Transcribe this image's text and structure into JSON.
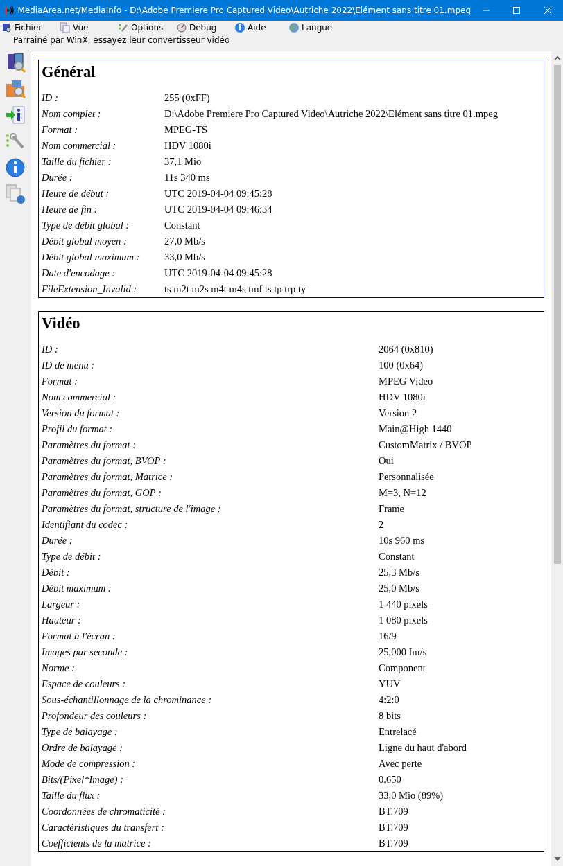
{
  "window": {
    "title": "MediaArea.net/MediaInfo - D:\\Adobe Premiere Pro Captured Video\\Autriche 2022\\Elément sans titre 01.mpeg"
  },
  "menu": [
    {
      "label": "Fichier",
      "kind": "file"
    },
    {
      "label": "Vue",
      "kind": "view"
    },
    {
      "label": "Options",
      "kind": "options"
    },
    {
      "label": "Debug",
      "kind": "debug"
    },
    {
      "label": "Aide",
      "kind": "help"
    },
    {
      "label": "Langue",
      "kind": "language"
    }
  ],
  "sponsor": "Parrainé par WinX, essayez leur convertisseur vidéo",
  "toolbar": [
    {
      "kind": "open-file"
    },
    {
      "kind": "open-folder"
    },
    {
      "kind": "export"
    },
    {
      "kind": "preferences"
    },
    {
      "kind": "about"
    },
    {
      "kind": "sheet"
    }
  ],
  "sections": [
    {
      "title": "Général",
      "kind": "general",
      "rows": [
        {
          "key": "ID :",
          "value": "255 (0xFF)"
        },
        {
          "key": "Nom complet :",
          "value": "D:\\Adobe Premiere Pro Captured Video\\Autriche 2022\\Elément sans titre 01.mpeg"
        },
        {
          "key": "Format :",
          "value": "MPEG-TS"
        },
        {
          "key": "Nom commercial :",
          "value": "HDV 1080i"
        },
        {
          "key": "Taille du fichier :",
          "value": "37,1 Mio"
        },
        {
          "key": "Durée :",
          "value": "11s 340 ms"
        },
        {
          "key": "Heure de début :",
          "value": "UTC 2019-04-04 09:45:28"
        },
        {
          "key": "Heure de fin :",
          "value": "UTC 2019-04-04 09:46:34"
        },
        {
          "key": "Type de débit global :",
          "value": "Constant"
        },
        {
          "key": "Débit global moyen :",
          "value": "27,0 Mb/s"
        },
        {
          "key": "Débit global maximum :",
          "value": "33,0 Mb/s"
        },
        {
          "key": "Date d'encodage :",
          "value": "UTC 2019-04-04 09:45:28"
        },
        {
          "key": "FileExtension_Invalid :",
          "value": "ts m2t m2s m4t m4s tmf ts tp trp ty"
        }
      ]
    },
    {
      "title": "Vidéo",
      "kind": "video",
      "rows": [
        {
          "key": "ID :",
          "value": "2064 (0x810)"
        },
        {
          "key": "ID de menu :",
          "value": "100 (0x64)"
        },
        {
          "key": "Format :",
          "value": "MPEG Video"
        },
        {
          "key": "Nom commercial :",
          "value": "HDV 1080i"
        },
        {
          "key": "Version du format :",
          "value": "Version 2"
        },
        {
          "key": "Profil du format :",
          "value": "Main@High 1440"
        },
        {
          "key": "Paramètres du format :",
          "value": "CustomMatrix / BVOP"
        },
        {
          "key": "Paramètres du format, BVOP :",
          "value": "Oui"
        },
        {
          "key": "Paramètres du format, Matrice :",
          "value": "Personnalisée"
        },
        {
          "key": "Paramètres du format, GOP :",
          "value": "M=3, N=12"
        },
        {
          "key": "Paramètres du format, structure de l'image :",
          "value": "Frame"
        },
        {
          "key": "Identifiant du codec :",
          "value": "2"
        },
        {
          "key": "Durée :",
          "value": "10s 960 ms"
        },
        {
          "key": "Type de débit :",
          "value": "Constant"
        },
        {
          "key": "Débit :",
          "value": "25,3 Mb/s"
        },
        {
          "key": "Débit maximum :",
          "value": "25,0 Mb/s"
        },
        {
          "key": "Largeur :",
          "value": "1 440 pixels"
        },
        {
          "key": "Hauteur :",
          "value": "1 080 pixels"
        },
        {
          "key": "Format à l'écran :",
          "value": "16/9"
        },
        {
          "key": "Images par seconde :",
          "value": "25,000 Im/s"
        },
        {
          "key": "Norme :",
          "value": "Component"
        },
        {
          "key": "Espace de couleurs :",
          "value": "YUV"
        },
        {
          "key": "Sous-échantillonnage de la chrominance :",
          "value": "4:2:0"
        },
        {
          "key": "Profondeur des couleurs :",
          "value": "8 bits"
        },
        {
          "key": "Type de balayage :",
          "value": "Entrelacé"
        },
        {
          "key": "Ordre de balayage :",
          "value": "Ligne du haut d'abord"
        },
        {
          "key": "Mode de compression :",
          "value": "Avec perte"
        },
        {
          "key": "Bits/(Pixel*Image) :",
          "value": "0.650"
        },
        {
          "key": "Taille du flux :",
          "value": "33,0 Mio (89%)"
        },
        {
          "key": "Coordonnées de chromaticité :",
          "value": "BT.709"
        },
        {
          "key": "Caractéristiques du transfert :",
          "value": "BT.709"
        },
        {
          "key": "Coefficients de la matrice :",
          "value": "BT.709"
        }
      ]
    }
  ]
}
